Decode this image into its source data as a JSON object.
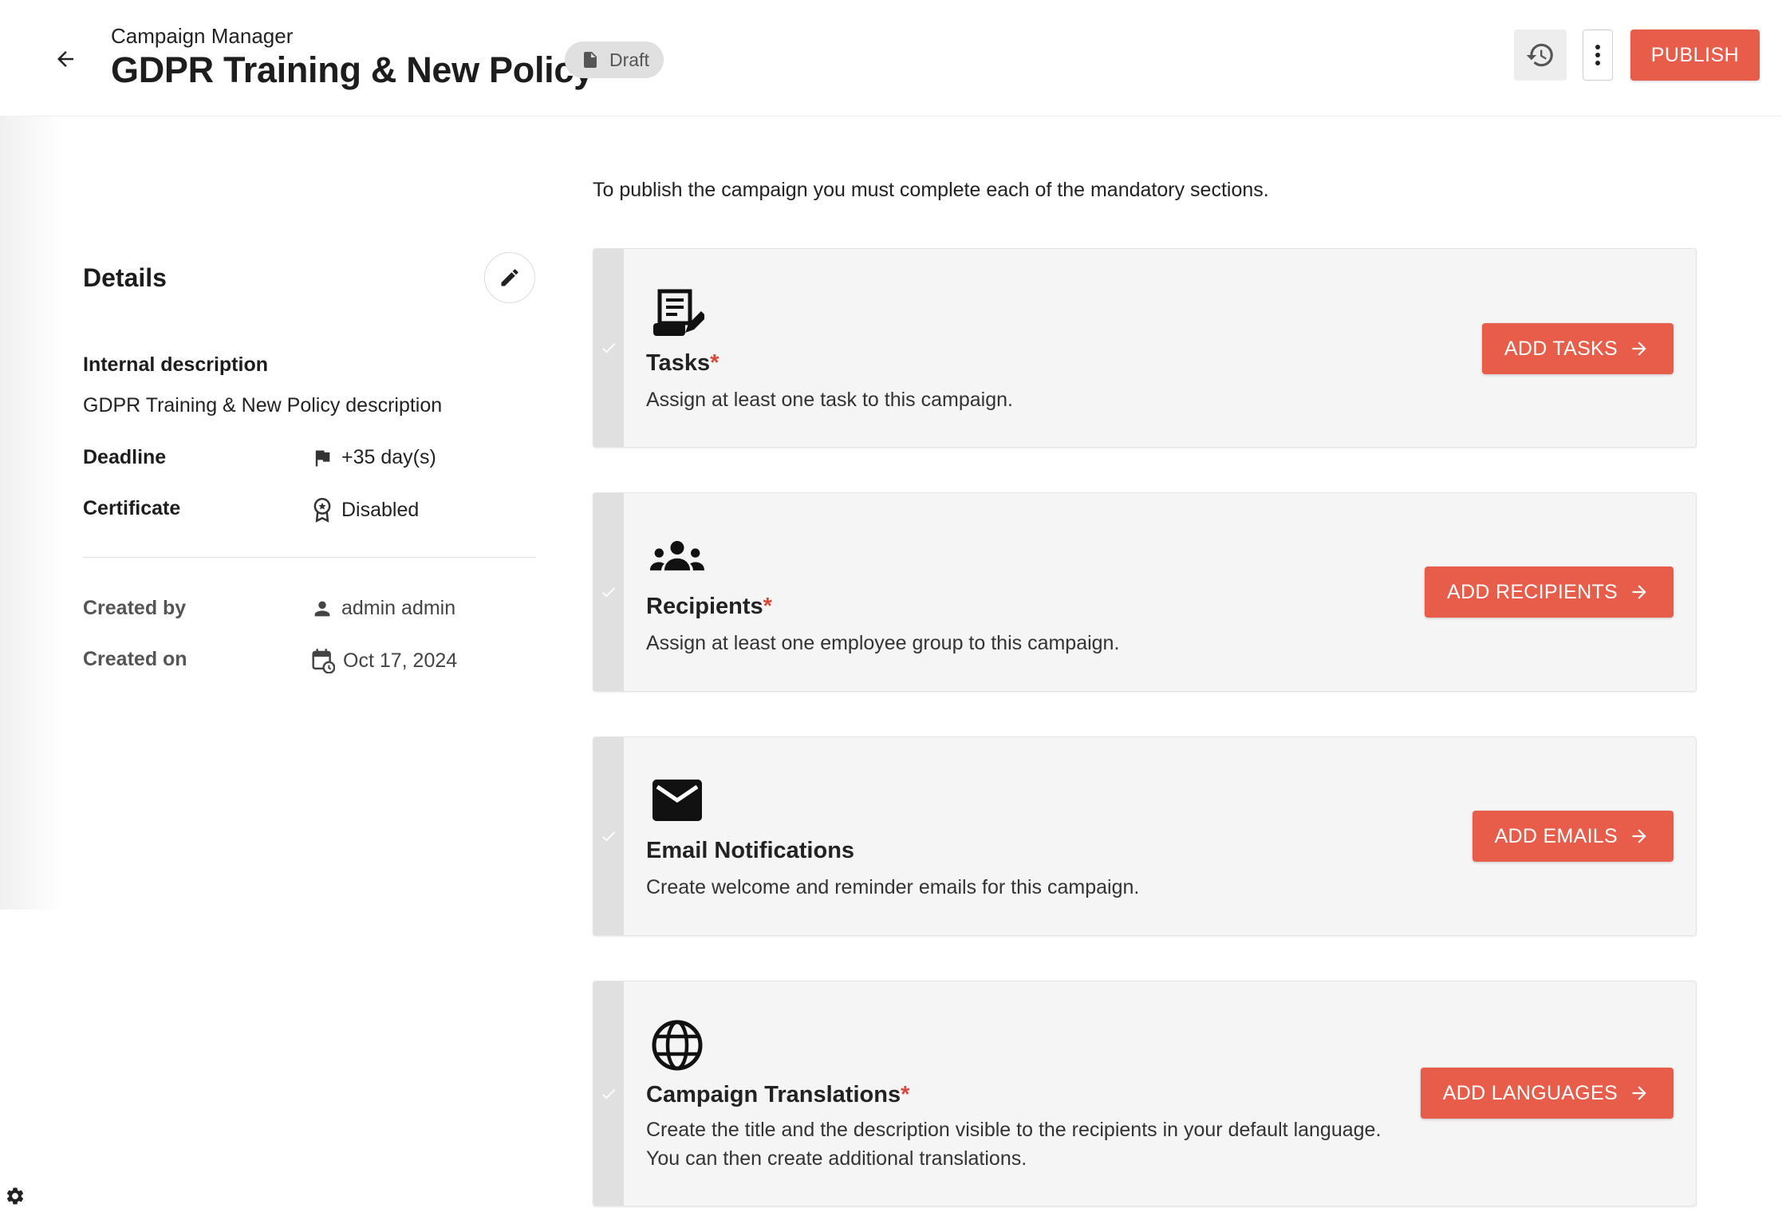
{
  "header": {
    "breadcrumb": "Campaign Manager",
    "title": "GDPR Training & New Policy",
    "status": "Draft",
    "publish_label": "PUBLISH",
    "icons": {
      "back": "arrow-left-icon",
      "status": "document-icon",
      "history": "history-icon",
      "more": "more-vertical-icon"
    }
  },
  "details": {
    "heading": "Details",
    "internal_description_label": "Internal description",
    "internal_description_value": "GDPR Training & New Policy description",
    "deadline_label": "Deadline",
    "deadline_value": "+35 day(s)",
    "certificate_label": "Certificate",
    "certificate_value": "Disabled",
    "created_by_label": "Created by",
    "created_by_value": "admin admin",
    "created_on_label": "Created on",
    "created_on_value": "Oct 17, 2024",
    "icons": {
      "edit": "pencil-icon",
      "deadline": "flag-icon",
      "certificate": "award-icon",
      "created_by": "person-icon",
      "created_on": "calendar-clock-icon"
    }
  },
  "main": {
    "intro": "To publish the campaign you must complete each of the mandatory sections.",
    "sections": [
      {
        "title": "Tasks",
        "required": true,
        "description": "Assign at least one task to this campaign.",
        "button": "ADD TASKS",
        "icon": "task-list-icon"
      },
      {
        "title": "Recipients",
        "required": true,
        "description": "Assign at least one employee group to this campaign.",
        "button": "ADD RECIPIENTS",
        "icon": "groups-icon"
      },
      {
        "title": "Email Notifications",
        "required": false,
        "description": "Create welcome and reminder emails for this campaign.",
        "button": "ADD EMAILS",
        "icon": "envelope-icon"
      },
      {
        "title": "Campaign Translations",
        "required": true,
        "description_line1": "Create the title and the description visible to the recipients in your default language.",
        "description_line2": "You can then create additional translations.",
        "button": "ADD LANGUAGES",
        "icon": "globe-icon"
      }
    ],
    "required_marker": "*"
  },
  "colors": {
    "accent": "#e85d4a",
    "required": "#d9463a",
    "card_bg": "#f5f5f5"
  }
}
